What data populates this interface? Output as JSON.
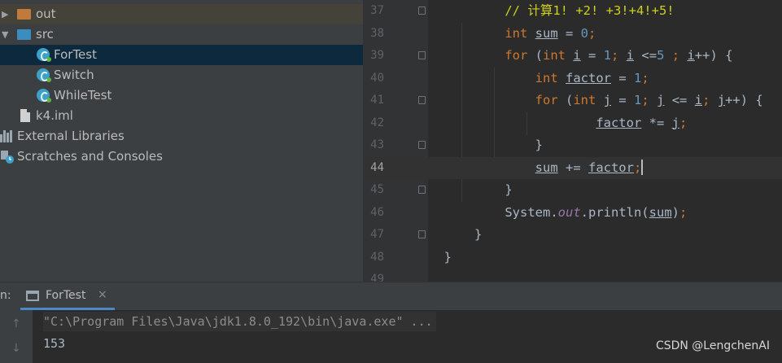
{
  "project_tree": {
    "items": [
      {
        "label": "out"
      },
      {
        "label": "src"
      },
      {
        "label": "ForTest"
      },
      {
        "label": "Switch"
      },
      {
        "label": "WhileTest"
      },
      {
        "label": "k4.iml"
      },
      {
        "label": "External Libraries"
      },
      {
        "label": "Scratches and Consoles"
      }
    ]
  },
  "editor": {
    "line_numbers": [
      "37",
      "38",
      "39",
      "40",
      "41",
      "42",
      "43",
      "44",
      "45",
      "46",
      "47",
      "48",
      "49"
    ],
    "code": {
      "l37_comment": "// 计算1! +2! +3!+4!+5!",
      "kw_int": "int",
      "kw_for": "for",
      "var_sum": "sum",
      "var_i": "i",
      "var_j": "j",
      "var_factor": "factor",
      "num_0": "0",
      "num_1": "1",
      "num_5": "5",
      "system": "System.",
      "out": "out",
      "println": ".println(",
      "brace_close": "}"
    }
  },
  "run_panel": {
    "label": "n:",
    "tab_label": "ForTest",
    "tab_close": "×",
    "console_command": "\"C:\\Program Files\\Java\\jdk1.8.0_192\\bin\\java.exe\" ...",
    "console_output": "153",
    "arrow_up": "↑",
    "arrow_down": "↓"
  },
  "watermark": "CSDN @LengchenAI",
  "colors": {
    "keyword": "#cc7832",
    "number": "#6897bb",
    "comment": "#cfcf1d",
    "selection": "#0d293e"
  }
}
